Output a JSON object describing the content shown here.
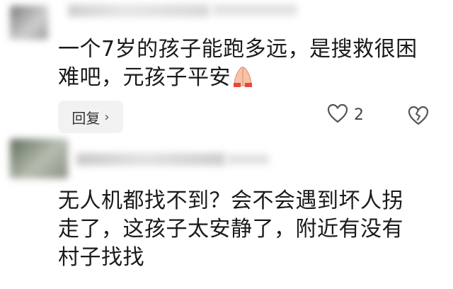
{
  "comments": [
    {
      "username": "",
      "text_lines": [
        "一个7岁的孩子能跑多远，是搜救很困",
        "难吧，元孩子平安"
      ],
      "emoji": "pray-icon",
      "reply_label": "回复",
      "like_count": "2"
    },
    {
      "username": "",
      "text_lines": [
        "无人机都找不到？会不会遇到坏人拐",
        "走了，这孩子太安静了，附近有没有",
        "村子找找"
      ]
    }
  ],
  "colors": {
    "reply_bg": "#f2f2f2",
    "icon_gray": "#555555",
    "meta_gray": "#b8b8b8"
  }
}
